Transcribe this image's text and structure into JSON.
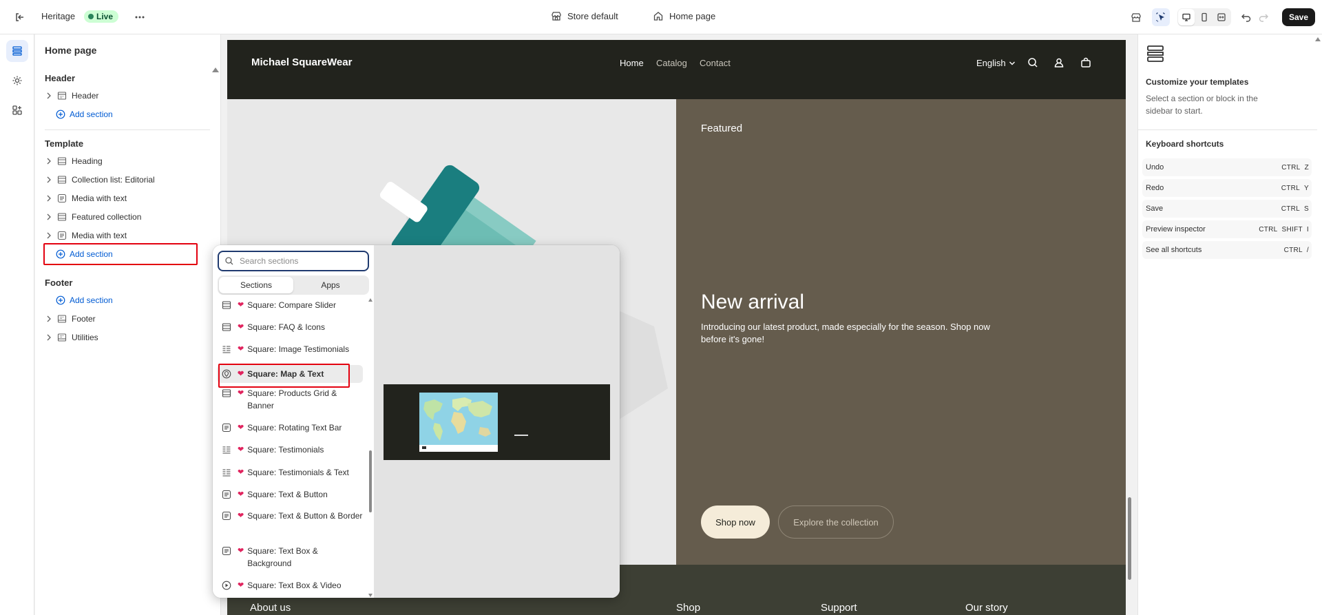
{
  "topbar": {
    "theme_name": "Heritage",
    "live_label": "Live",
    "store_label": "Store default",
    "page_label": "Home page",
    "save_label": "Save"
  },
  "sidebar": {
    "title": "Home page",
    "header_group": "Header",
    "header_items": [
      {
        "label": "Header"
      }
    ],
    "header_add": "Add section",
    "template_group": "Template",
    "template_items": [
      {
        "label": "Heading"
      },
      {
        "label": "Collection list: Editorial"
      },
      {
        "label": "Media with text"
      },
      {
        "label": "Featured collection"
      },
      {
        "label": "Media with text"
      }
    ],
    "template_add": "Add section",
    "footer_group": "Footer",
    "footer_add": "Add section",
    "footer_items": [
      {
        "label": "Footer"
      },
      {
        "label": "Utilities"
      }
    ]
  },
  "preview": {
    "logo": "Michael SquareWear",
    "nav": [
      "Home",
      "Catalog",
      "Contact"
    ],
    "language": "English",
    "featured": "Featured",
    "heading": "New arrival",
    "description": "Introducing our latest product, made especially for the season. Shop now before it's gone!",
    "shop_now": "Shop now",
    "explore": "Explore the collection",
    "footer_cols": [
      "About us",
      "Shop",
      "Support",
      "Our story"
    ]
  },
  "popover": {
    "search_placeholder": "Search sections",
    "tabs": [
      "Sections",
      "Apps"
    ],
    "items": [
      {
        "label": "Square: Compare Slider",
        "icon": "columns-icon"
      },
      {
        "label": "Square: FAQ & Icons",
        "icon": "columns-icon"
      },
      {
        "label": "Square: Image Testimonials",
        "icon": "list-icon"
      },
      {
        "label": "Square: Map & Text",
        "icon": "map-pin-icon",
        "selected": true
      },
      {
        "label": "Square: Products Grid & Banner",
        "icon": "columns-icon"
      },
      {
        "label": "Square: Rotating Text Bar",
        "icon": "text-block-icon"
      },
      {
        "label": "Square: Testimonials",
        "icon": "list-icon"
      },
      {
        "label": "Square: Testimonials & Text",
        "icon": "list-icon"
      },
      {
        "label": "Square: Text & Button",
        "icon": "text-block-icon"
      },
      {
        "label": "Square: Text & Button & Border",
        "icon": "text-block-icon"
      },
      {
        "label": "Square: Text Box & Background",
        "icon": "text-block-icon"
      },
      {
        "label": "Square: Text Box & Video",
        "icon": "play-icon"
      }
    ],
    "heart": "❤"
  },
  "rightpanel": {
    "title": "Customize your templates",
    "subtitle": "Select a section or block in the sidebar to start.",
    "shortcuts_title": "Keyboard shortcuts",
    "shortcuts": [
      {
        "label": "Undo",
        "keys": [
          "CTRL",
          "Z"
        ]
      },
      {
        "label": "Redo",
        "keys": [
          "CTRL",
          "Y"
        ]
      },
      {
        "label": "Save",
        "keys": [
          "CTRL",
          "S"
        ]
      },
      {
        "label": "Preview inspector",
        "keys": [
          "CTRL",
          "SHIFT",
          "I"
        ]
      },
      {
        "label": "See all shortcuts",
        "keys": [
          "CTRL",
          "/"
        ]
      }
    ]
  },
  "colors": {
    "accent": "#005bd3",
    "live_bg": "#cdfed4",
    "header_dark": "#22231d",
    "panel_olive": "#655c4d",
    "highlight_red": "#e3000f"
  }
}
